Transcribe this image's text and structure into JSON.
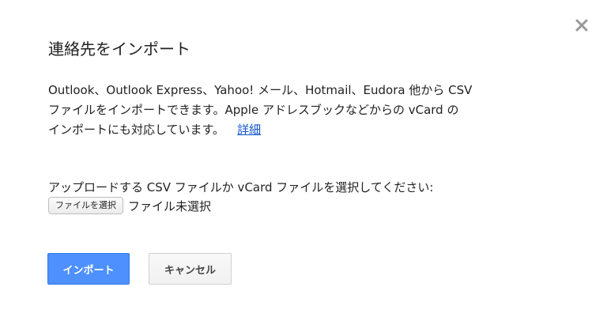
{
  "dialog": {
    "title": "連絡先をインポート",
    "close_icon": "close-icon",
    "description_lines": [
      "Outlook、Outlook Express、Yahoo! メール、Hotmail、Eudora 他から CSV",
      "ファイルをインポートできます。Apple アドレスブックなどからの vCard の",
      "インポートにも対応しています。"
    ],
    "details_link": "詳細",
    "upload_label": "アップロードする CSV ファイルか vCard ファイルを選択してください:",
    "file_button": "ファイルを選択",
    "file_status": "ファイル未選択",
    "import_button": "インポート",
    "cancel_button": "キャンセル"
  },
  "colors": {
    "primary_button": "#4d90fe",
    "link": "#1155cc",
    "close_icon": "#999999"
  }
}
